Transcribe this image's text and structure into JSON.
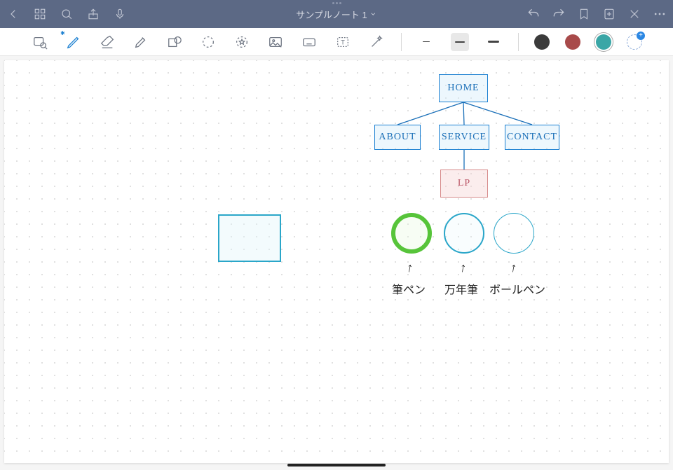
{
  "header": {
    "title": "サンプルノート 1"
  },
  "sitemap": {
    "home": "HOME",
    "about": "ABOUT",
    "service": "SERVICE",
    "contact": "CONTACT",
    "lp": "LP"
  },
  "pen_labels": {
    "brush": "筆ペン",
    "fountain": "万年筆",
    "ballpoint": "ボールペン"
  },
  "tools": [
    "zoom-tool",
    "pen-tool",
    "eraser-tool",
    "highlighter-tool",
    "shape-tool",
    "lasso-tool",
    "stamp-tool",
    "image-tool",
    "keyboard-tool",
    "text-tool",
    "wand-tool"
  ],
  "thicknesses": {
    "widths": [
      10,
      14,
      16
    ],
    "selected": 1
  },
  "colors": [
    {
      "name": "black",
      "hex": "#3b3b3b"
    },
    {
      "name": "red",
      "hex": "#a84a4a"
    },
    {
      "name": "teal",
      "hex": "#3aa6a6"
    }
  ],
  "selected_color": 2
}
